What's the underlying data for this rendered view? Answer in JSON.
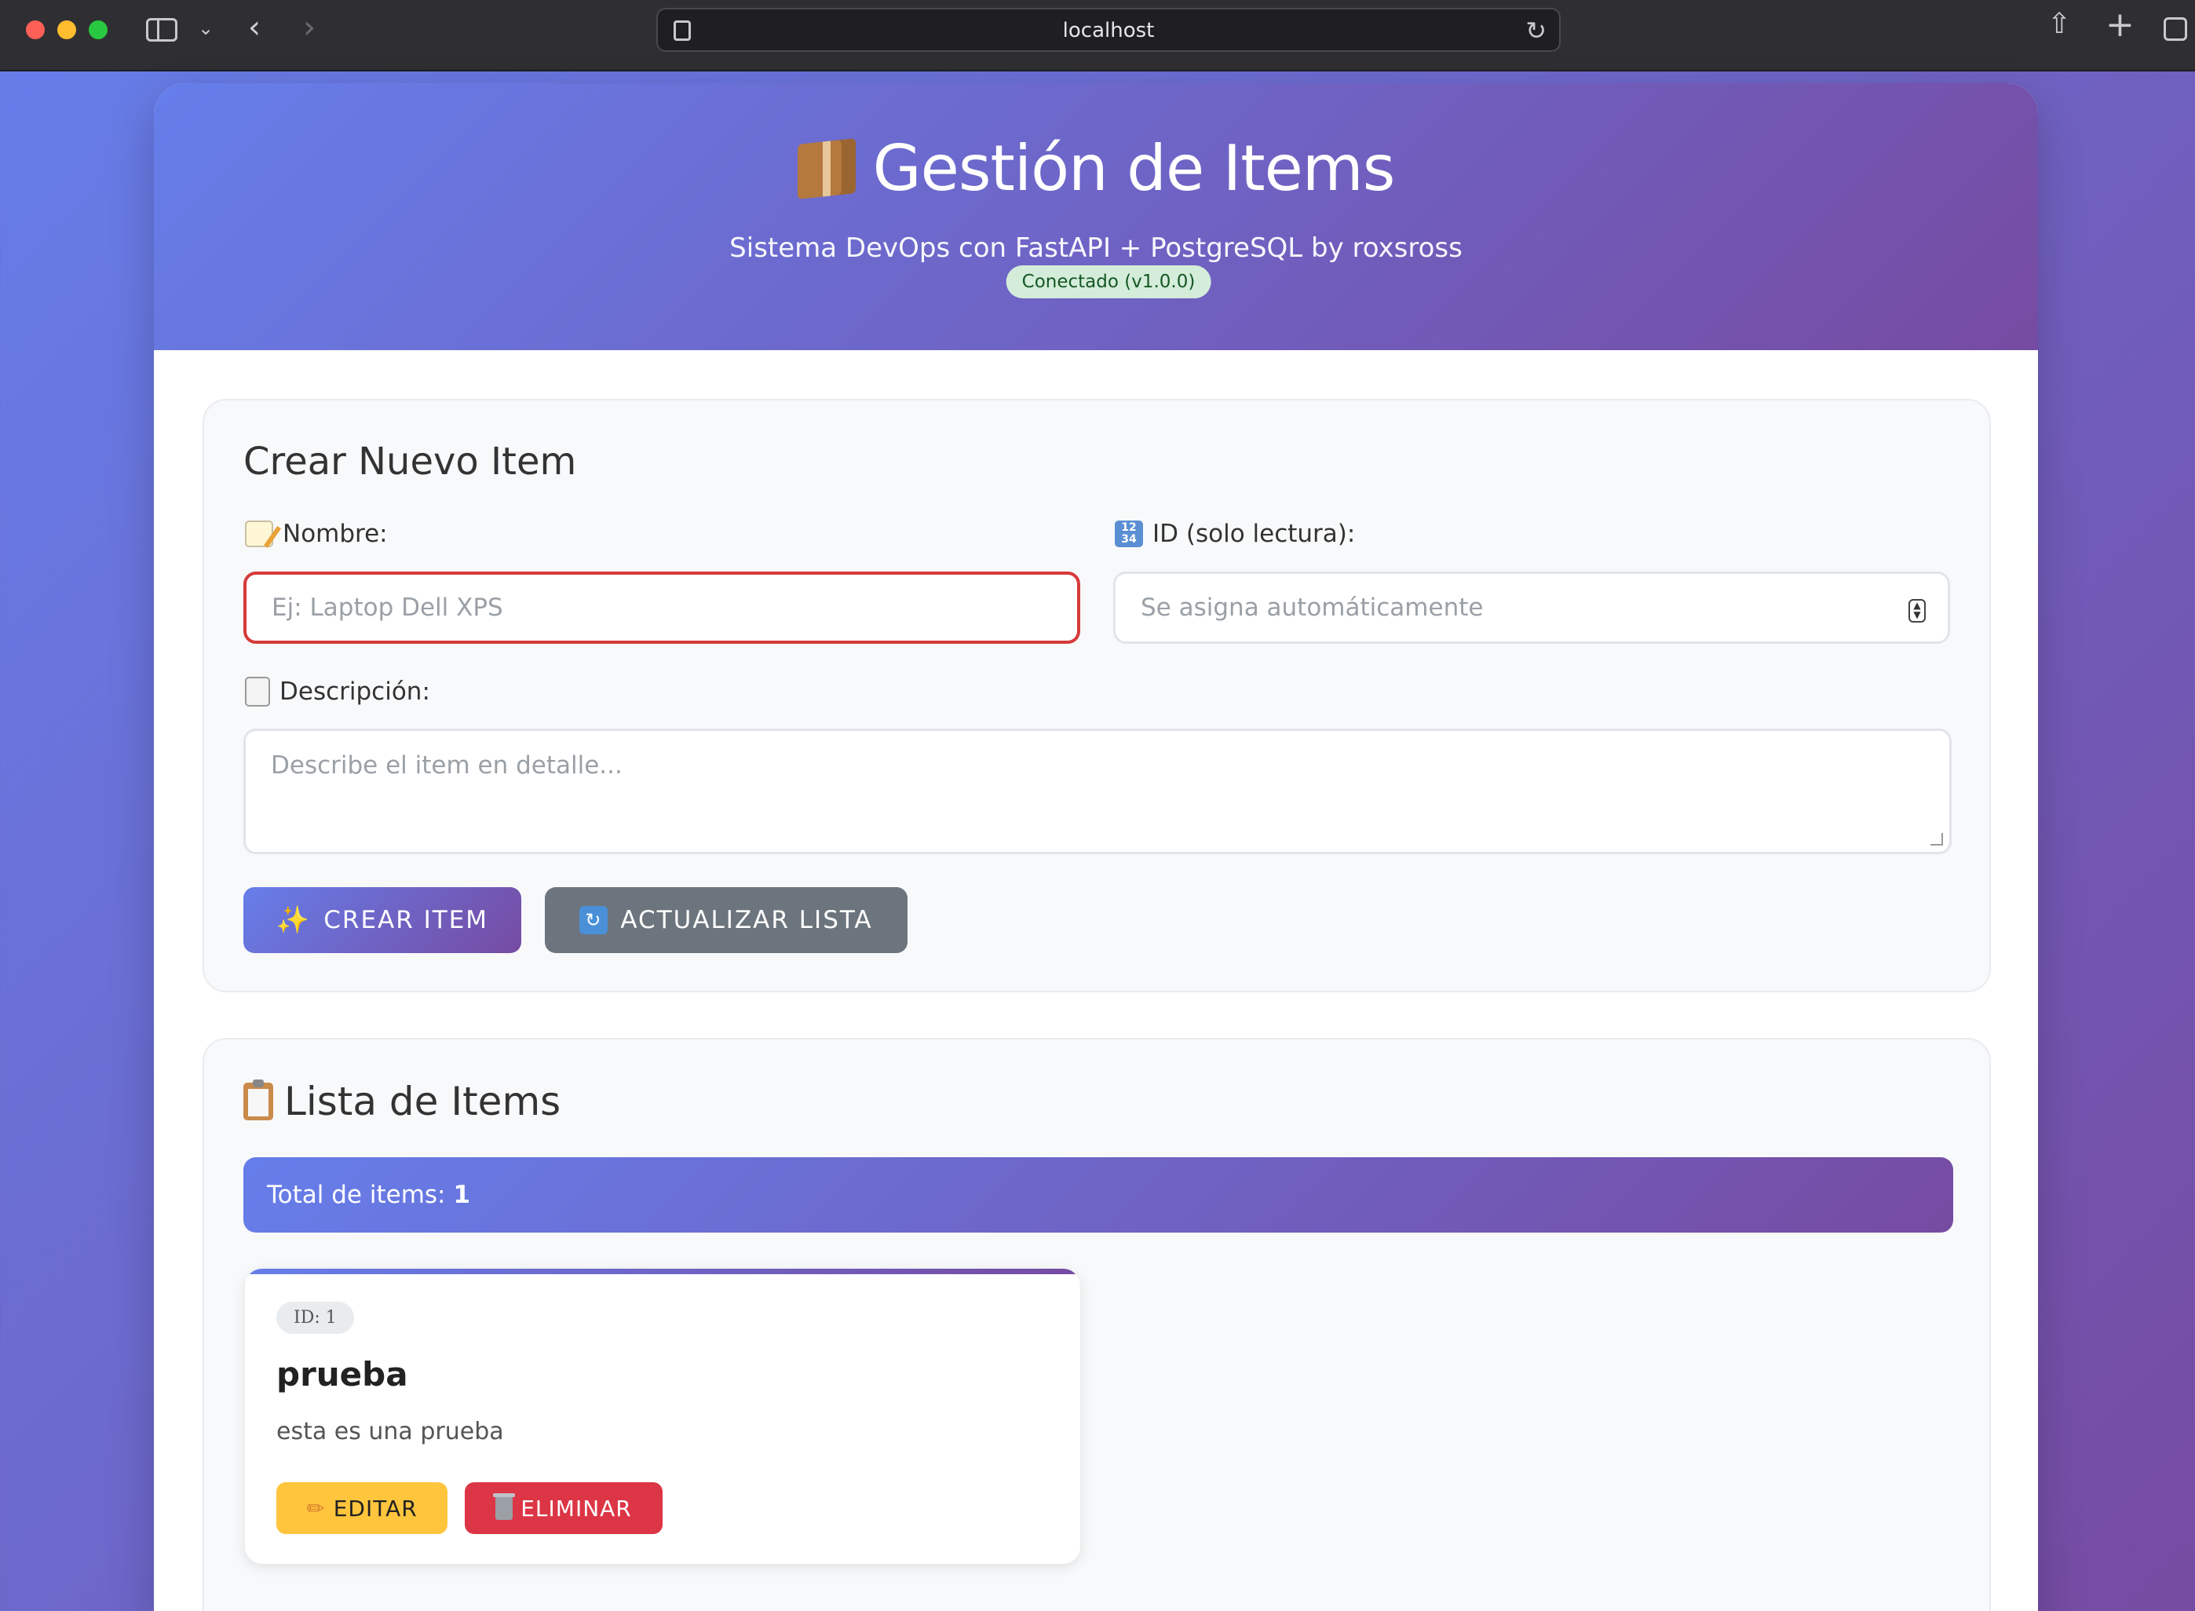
{
  "browser": {
    "url": "localhost"
  },
  "header": {
    "title": "Gestión de Items",
    "subtitle": "Sistema DevOps con FastAPI + PostgreSQL by roxsross",
    "status": "Conectado (v1.0.0)"
  },
  "form": {
    "heading": "Crear Nuevo Item",
    "name_label": "Nombre:",
    "name_placeholder": "Ej: Laptop Dell XPS",
    "id_label": "ID (solo lectura):",
    "id_placeholder": "Se asigna automáticamente",
    "description_label": "Descripción:",
    "description_placeholder": "Describe el item en detalle...",
    "create_button": "CREAR ITEM",
    "refresh_button": "ACTUALIZAR LISTA"
  },
  "list": {
    "heading": "Lista de Items",
    "total_label": "Total de items:",
    "total_count": "1",
    "items": [
      {
        "id_label": "ID: 1",
        "name": "prueba",
        "description": "esta es una prueba",
        "edit_label": "EDITAR",
        "delete_label": "ELIMINAR"
      }
    ]
  }
}
